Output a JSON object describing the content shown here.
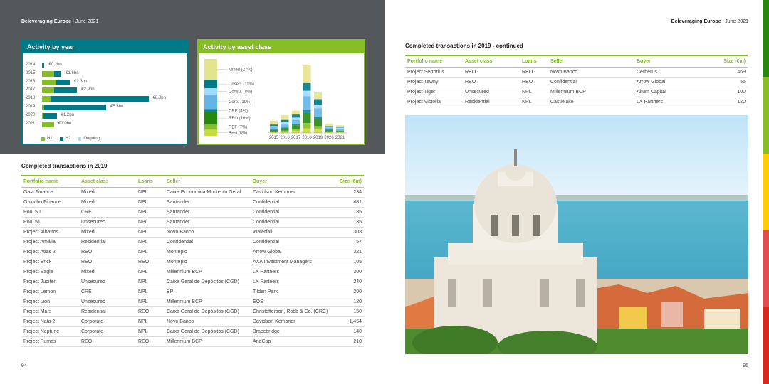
{
  "header": {
    "left_title": "Deleveraging Europe",
    "left_date": " | June 2021",
    "right_title": "Deleveraging Europe",
    "right_date": " | June 2021"
  },
  "activity_by_year": {
    "title": "Activity by year",
    "legend": [
      "H1",
      "H2",
      "Ongoing"
    ],
    "colors": {
      "h1": "#86bc25",
      "h2": "#007a87",
      "ongoing": "#a6dbe6"
    },
    "rows": [
      {
        "year": "2014",
        "h1": 0.0,
        "h2": 0.2,
        "ongoing": 0,
        "label": "€0.2bn"
      },
      {
        "year": "2015",
        "h1": 1.0,
        "h2": 0.6,
        "ongoing": 0,
        "label": "€1.6bn"
      },
      {
        "year": "2016",
        "h1": 1.2,
        "h2": 1.1,
        "ongoing": 0,
        "label": "€2.3bn"
      },
      {
        "year": "2017",
        "h1": 1.0,
        "h2": 1.9,
        "ongoing": 0,
        "label": "€2.9bn"
      },
      {
        "year": "2018",
        "h1": 0.7,
        "h2": 8.1,
        "ongoing": 0,
        "label": "€8.8bn"
      },
      {
        "year": "2019",
        "h1": 0.2,
        "h2": 5.1,
        "ongoing": 0,
        "label": "€5.3bn"
      },
      {
        "year": "2020",
        "h1": 0.1,
        "h2": 1.1,
        "ongoing": 0,
        "label": "€1.2bn"
      },
      {
        "year": "2021",
        "h1": 1.0,
        "h2": 0.0,
        "ongoing": 0,
        "label": "€1.0bn"
      }
    ]
  },
  "chart_data": {
    "type": "area",
    "title": "Activity by asset class",
    "x": [
      "2015",
      "2016",
      "2017",
      "2018",
      "2019",
      "2020",
      "2021"
    ],
    "series": [
      {
        "name": "Resi (8%)",
        "color": "#c8dc3c",
        "values": [
          0.1,
          0.1,
          0.3,
          0.6,
          0.5,
          0.1,
          0.1
        ]
      },
      {
        "name": "REF (7%)",
        "color": "#86bc25",
        "values": [
          0.1,
          0.2,
          0.2,
          0.7,
          0.4,
          0.1,
          0.1
        ]
      },
      {
        "name": "REO (16%)",
        "color": "#26890d",
        "values": [
          0.2,
          0.3,
          0.5,
          1.3,
          0.9,
          0.2,
          0.1
        ]
      },
      {
        "name": "CRE (4%)",
        "color": "#0d8390",
        "values": [
          0.1,
          0.1,
          0.2,
          0.4,
          0.3,
          0.1,
          0.0
        ]
      },
      {
        "name": "Corp. (19%)",
        "color": "#62b5e5",
        "values": [
          0.3,
          0.4,
          0.5,
          1.8,
          1.1,
          0.2,
          0.2
        ]
      },
      {
        "name": "Consu. (8%)",
        "color": "#a0dcff",
        "values": [
          0.1,
          0.3,
          0.3,
          0.7,
          0.5,
          0.1,
          0.2
        ]
      },
      {
        "name": "Unsec. (11%)",
        "color": "#007a87",
        "values": [
          0.2,
          0.3,
          0.4,
          1.0,
          0.7,
          0.1,
          0.1
        ]
      },
      {
        "name": "Mixed (27%)",
        "color": "#e3e48d",
        "values": [
          0.5,
          0.6,
          0.5,
          2.3,
          0.9,
          0.3,
          0.2
        ]
      }
    ]
  },
  "asset_panel": {
    "title": "Activity by asset class"
  },
  "table_2019": {
    "title": "Completed transactions in 2019",
    "headers": [
      "Portfolio name",
      "Asset class",
      "Loans",
      "Seller",
      "Buyer",
      "Size (€m)"
    ],
    "rows": [
      [
        "Gaia Finance",
        "Mixed",
        "NPL",
        "Caixa Economica Montepio Geral",
        "Davidson Kempner",
        "234"
      ],
      [
        "Guincho Finance",
        "Mixed",
        "NPL",
        "Santander",
        "Confidential",
        "481"
      ],
      [
        "Pool 50",
        "CRE",
        "NPL",
        "Santander",
        "Confidential",
        "85"
      ],
      [
        "Pool 51",
        "Unsecured",
        "NPL",
        "Santander",
        "Confidential",
        "135"
      ],
      [
        "Project Albatros",
        "Mixed",
        "NPL",
        "Novo Banco",
        "Waterfall",
        "303"
      ],
      [
        "Project Amália",
        "Residential",
        "NPL",
        "Confidential",
        "Confidential",
        "57"
      ],
      [
        "Project Atlas 2",
        "REO",
        "NPL",
        "Montepio",
        "Arrow Global",
        "321"
      ],
      [
        "Project Brick",
        "REO",
        "REO",
        "Montepio",
        "AXA Investment Managers",
        "105"
      ],
      [
        "Project Eagle",
        "Mixed",
        "NPL",
        "Millennium BCP",
        "LX Partners",
        "300"
      ],
      [
        "Project Jupiter",
        "Unsecured",
        "NPL",
        "Caixa Geral de Depósitos (CGD)",
        "LX Partners",
        "240"
      ],
      [
        "Project Lemon",
        "CRE",
        "NPL",
        "BPI",
        "Tilden Park",
        "200"
      ],
      [
        "Project Lion",
        "Unsecured",
        "NPL",
        "Millennium BCP",
        "EOS",
        "120"
      ],
      [
        "Project Mars",
        "Residential",
        "REO",
        "Caixa Geral de Depósitos (CGD)",
        "Christofferson, Robb & Co. (CRC)",
        "150"
      ],
      [
        "Project Nata 2",
        "Corporate",
        "NPL",
        "Novo Banco",
        "Davidson Kempner",
        "1,454"
      ],
      [
        "Project Neptune",
        "Corporate",
        "NPL",
        "Caixa Geral de Depósitos (CGD)",
        "Bracebridge",
        "140"
      ],
      [
        "Project Pumas",
        "REO",
        "REO",
        "Millennium BCP",
        "AnaCap",
        "210"
      ]
    ]
  },
  "table_cont": {
    "title": "Completed transactions in 2019 - continued",
    "headers": [
      "Portfolio name",
      "Asset class",
      "Loans",
      "Seller",
      "Buyer",
      "Size (€m)"
    ],
    "rows": [
      [
        "Project Sertorius",
        "REO",
        "REO",
        "Novo Banco",
        "Cerberus",
        "469"
      ],
      [
        "Project Tawny",
        "REO",
        "REO",
        "Confidential",
        "Arrow Global",
        "55"
      ],
      [
        "Project Tiger",
        "Unsecured",
        "NPL",
        "Millennium BCP",
        "Altum Capital",
        "100"
      ],
      [
        "Project Victoria",
        "Residential",
        "NPL",
        "Castlelake",
        "LX Partners",
        "120"
      ]
    ]
  },
  "page_numbers": {
    "left": "94",
    "right": "95"
  },
  "side_strip_colors": [
    "#26890d",
    "#86bc25",
    "#ffcd00",
    "#e04e4e",
    "#da291c"
  ]
}
